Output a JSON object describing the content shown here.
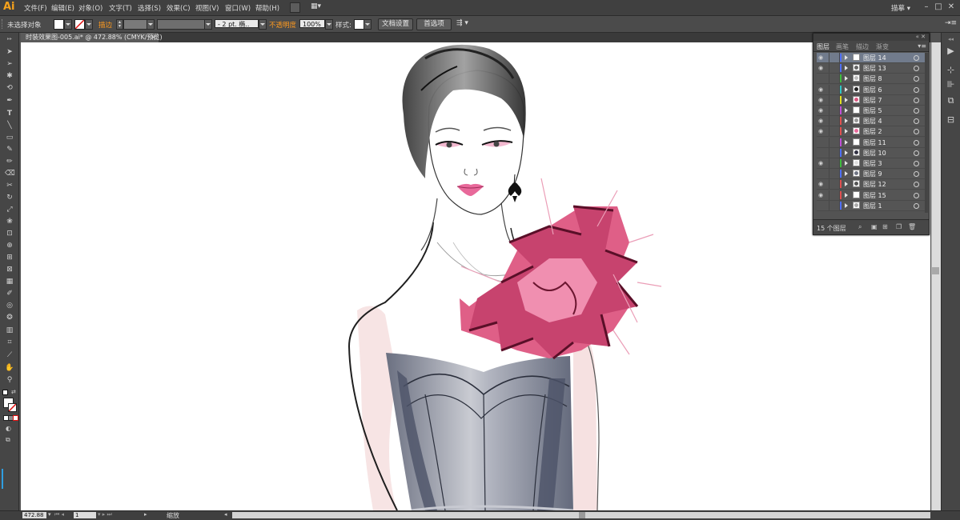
{
  "app": {
    "logo": "Ai",
    "workspace": "描摹"
  },
  "menu": [
    "文件(F)",
    "编辑(E)",
    "对象(O)",
    "文字(T)",
    "选择(S)",
    "效果(C)",
    "视图(V)",
    "窗口(W)",
    "帮助(H)"
  ],
  "control": {
    "selection": "未选择对象",
    "stroke_label": "描边",
    "stroke_weight": "- 2 pt. 椭..",
    "opacity_label": "不透明度",
    "opacity_value": "100%",
    "style_label": "样式:",
    "doc_setup": "文档设置",
    "preferences": "首选项"
  },
  "document": {
    "tab_title": "时装效果图-005.ai* @ 472.88% (CMYK/预览)",
    "close": "×"
  },
  "status": {
    "zoom": "472.88",
    "page": "1",
    "text": "缩放"
  },
  "layers_panel": {
    "tabs": [
      "图层",
      "画笔",
      "描边",
      "渐变"
    ],
    "count_label": "15 个图层",
    "layers": [
      {
        "name": "图层 14",
        "visible": true,
        "color": "#4f6fff",
        "selected": true,
        "thumb": "blank"
      },
      {
        "name": "图层 13",
        "visible": true,
        "color": "#4f6fff",
        "selected": false,
        "thumb": "eyes"
      },
      {
        "name": "图层 8",
        "visible": false,
        "color": "#3dbd3d",
        "selected": false,
        "thumb": "sketch"
      },
      {
        "name": "图层 6",
        "visible": true,
        "color": "#2fc6c6",
        "selected": false,
        "thumb": "earring"
      },
      {
        "name": "图层 7",
        "visible": true,
        "color": "#e0e020",
        "selected": false,
        "thumb": "flower"
      },
      {
        "name": "图层 5",
        "visible": true,
        "color": "#c04fd8",
        "selected": false,
        "thumb": "blank"
      },
      {
        "name": "图层 4",
        "visible": true,
        "color": "#e05050",
        "selected": false,
        "thumb": "hair"
      },
      {
        "name": "图层 2",
        "visible": true,
        "color": "#e05050",
        "selected": false,
        "thumb": "lips"
      },
      {
        "name": "图层 11",
        "visible": false,
        "color": "#c04fd8",
        "selected": false,
        "thumb": "blank"
      },
      {
        "name": "图层 10",
        "visible": false,
        "color": "#4f6fff",
        "selected": false,
        "thumb": "bust"
      },
      {
        "name": "图层 3",
        "visible": true,
        "color": "#3dbd3d",
        "selected": false,
        "thumb": "face"
      },
      {
        "name": "图层 9",
        "visible": false,
        "color": "#4f6fff",
        "selected": false,
        "thumb": "dress"
      },
      {
        "name": "图层 12",
        "visible": true,
        "color": "#e05050",
        "selected": false,
        "thumb": "figure"
      },
      {
        "name": "图层 15",
        "visible": true,
        "color": "#e05050",
        "selected": false,
        "thumb": "blank"
      },
      {
        "name": "图层 1",
        "visible": false,
        "color": "#4f6fff",
        "selected": false,
        "thumb": "line"
      }
    ]
  },
  "colors": {
    "accent": "#ff9a1f",
    "selection": "#717b8c",
    "dress": "#6f7483",
    "flower": "#d9577f"
  }
}
